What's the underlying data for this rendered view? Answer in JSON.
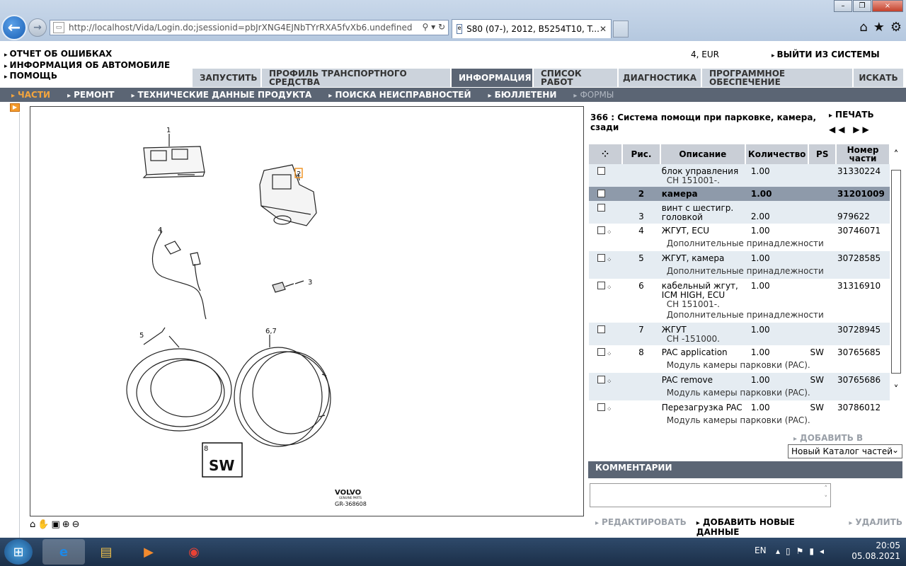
{
  "browser": {
    "url": "http://localhost/Vida/Login.do;jsessionid=pbJrXNG4EJNbTYrRXA5fvXb6.undefined",
    "tab_title": "S80 (07-), 2012, B5254T10, T...",
    "close": "×"
  },
  "header": {
    "links": [
      "ОТЧЕТ ОБ ОШИБКАХ",
      "ИНФОРМАЦИЯ ОБ АВТОМОБИЛЕ",
      "ПОМОЩЬ"
    ],
    "currency": "4, EUR",
    "logout": "ВЫЙТИ ИЗ СИСТЕМЫ"
  },
  "main_tabs": [
    {
      "label": "ЗАПУСТИТЬ",
      "active": false
    },
    {
      "label": "ПРОФИЛЬ ТРАНСПОРТНОГО СРЕДСТВА",
      "active": false
    },
    {
      "label": "ИНФОРМАЦИЯ",
      "active": true
    },
    {
      "label": "СПИСОК РАБОТ",
      "active": false
    },
    {
      "label": "ДИАГНОСТИКА",
      "active": false
    },
    {
      "label": "ПРОГРАММНОЕ ОБЕСПЕЧЕНИЕ",
      "active": false
    },
    {
      "label": "ИСКАТЬ",
      "active": false
    }
  ],
  "sub_nav": [
    {
      "label": "ЧАСТИ",
      "state": "active"
    },
    {
      "label": "РЕМОНТ",
      "state": "normal"
    },
    {
      "label": "ТЕХНИЧЕСКИЕ ДАННЫЕ ПРОДУКТА",
      "state": "normal"
    },
    {
      "label": "ПОИСКА НЕИСПРАВНОСТЕЙ",
      "state": "normal"
    },
    {
      "label": "БЮЛЛЕТЕНИ",
      "state": "normal"
    },
    {
      "label": "ФОРМЫ",
      "state": "dim"
    }
  ],
  "diagram": {
    "callouts": [
      "1",
      "2",
      "3",
      "4",
      "5",
      "6,7",
      "8"
    ],
    "sw_label": "SW",
    "brand": "VOLVO",
    "brand_sub": "GENUINE PARTS",
    "ref": "GR-368608"
  },
  "parts": {
    "title": "366 : Система помощи при парковке, камера, сзади",
    "print": "ПЕЧАТЬ",
    "nav_prev": "◀◀",
    "nav_next": "▶▶",
    "columns": [
      "Рис.",
      "Описание",
      "Количество",
      "PS",
      "Номер части"
    ],
    "rows": [
      {
        "fig": "",
        "desc": "блок управления",
        "sub": "CH 151001-.",
        "note": "",
        "qty": "1.00",
        "ps": "",
        "part": "31330224",
        "sel": false,
        "alt": true,
        "menu": false
      },
      {
        "fig": "2",
        "desc": "камера",
        "sub": "",
        "note": "",
        "qty": "1.00",
        "ps": "",
        "part": "31201009",
        "sel": true,
        "alt": false,
        "menu": false
      },
      {
        "fig": "3",
        "desc": "винт с шестигр. головкой",
        "sub": "",
        "note": "",
        "qty": "2.00",
        "ps": "",
        "part": "979622",
        "sel": false,
        "alt": true,
        "menu": false
      },
      {
        "fig": "4",
        "desc": "ЖГУТ, ECU",
        "sub": "",
        "note": "Дополнительные принадлежности",
        "qty": "1.00",
        "ps": "",
        "part": "30746071",
        "sel": false,
        "alt": false,
        "menu": true
      },
      {
        "fig": "5",
        "desc": "ЖГУТ, камера",
        "sub": "",
        "note": "Дополнительные принадлежности",
        "qty": "1.00",
        "ps": "",
        "part": "30728585",
        "sel": false,
        "alt": true,
        "menu": true
      },
      {
        "fig": "6",
        "desc": "кабельный жгут, ICM HIGH, ECU",
        "sub": "CH 151001-.",
        "note": "Дополнительные принадлежности",
        "qty": "1.00",
        "ps": "",
        "part": "31316910",
        "sel": false,
        "alt": false,
        "menu": true
      },
      {
        "fig": "7",
        "desc": "ЖГУТ",
        "sub": "CH -151000.",
        "note": "",
        "qty": "1.00",
        "ps": "",
        "part": "30728945",
        "sel": false,
        "alt": true,
        "menu": false
      },
      {
        "fig": "8",
        "desc": "PAC application",
        "sub": "",
        "note": "Модуль камеры парковки (PAC).",
        "qty": "1.00",
        "ps": "SW",
        "part": "30765685",
        "sel": false,
        "alt": false,
        "menu": true
      },
      {
        "fig": "",
        "desc": "PAC remove",
        "sub": "",
        "note": "Модуль камеры парковки (PAC).",
        "qty": "1.00",
        "ps": "SW",
        "part": "30765686",
        "sel": false,
        "alt": true,
        "menu": true
      },
      {
        "fig": "",
        "desc": "Перезагрузка PAC",
        "sub": "",
        "note": "Модуль камеры парковки (PAC).",
        "qty": "1.00",
        "ps": "SW",
        "part": "30786012",
        "sel": false,
        "alt": false,
        "menu": true
      }
    ],
    "add_to_list": "ДОБАВИТЬ В СПИСОК",
    "catalog_select": "Новый Каталог частей"
  },
  "comments": {
    "header": "КОММЕНТАРИИ",
    "edit": "РЕДАКТИРОВАТЬ",
    "add": "ДОБАВИТЬ НОВЫЕ ДАННЫЕ",
    "delete": "УДАЛИТЬ"
  },
  "taskbar": {
    "lang": "EN",
    "time": "20:05",
    "date": "05.08.2021"
  }
}
